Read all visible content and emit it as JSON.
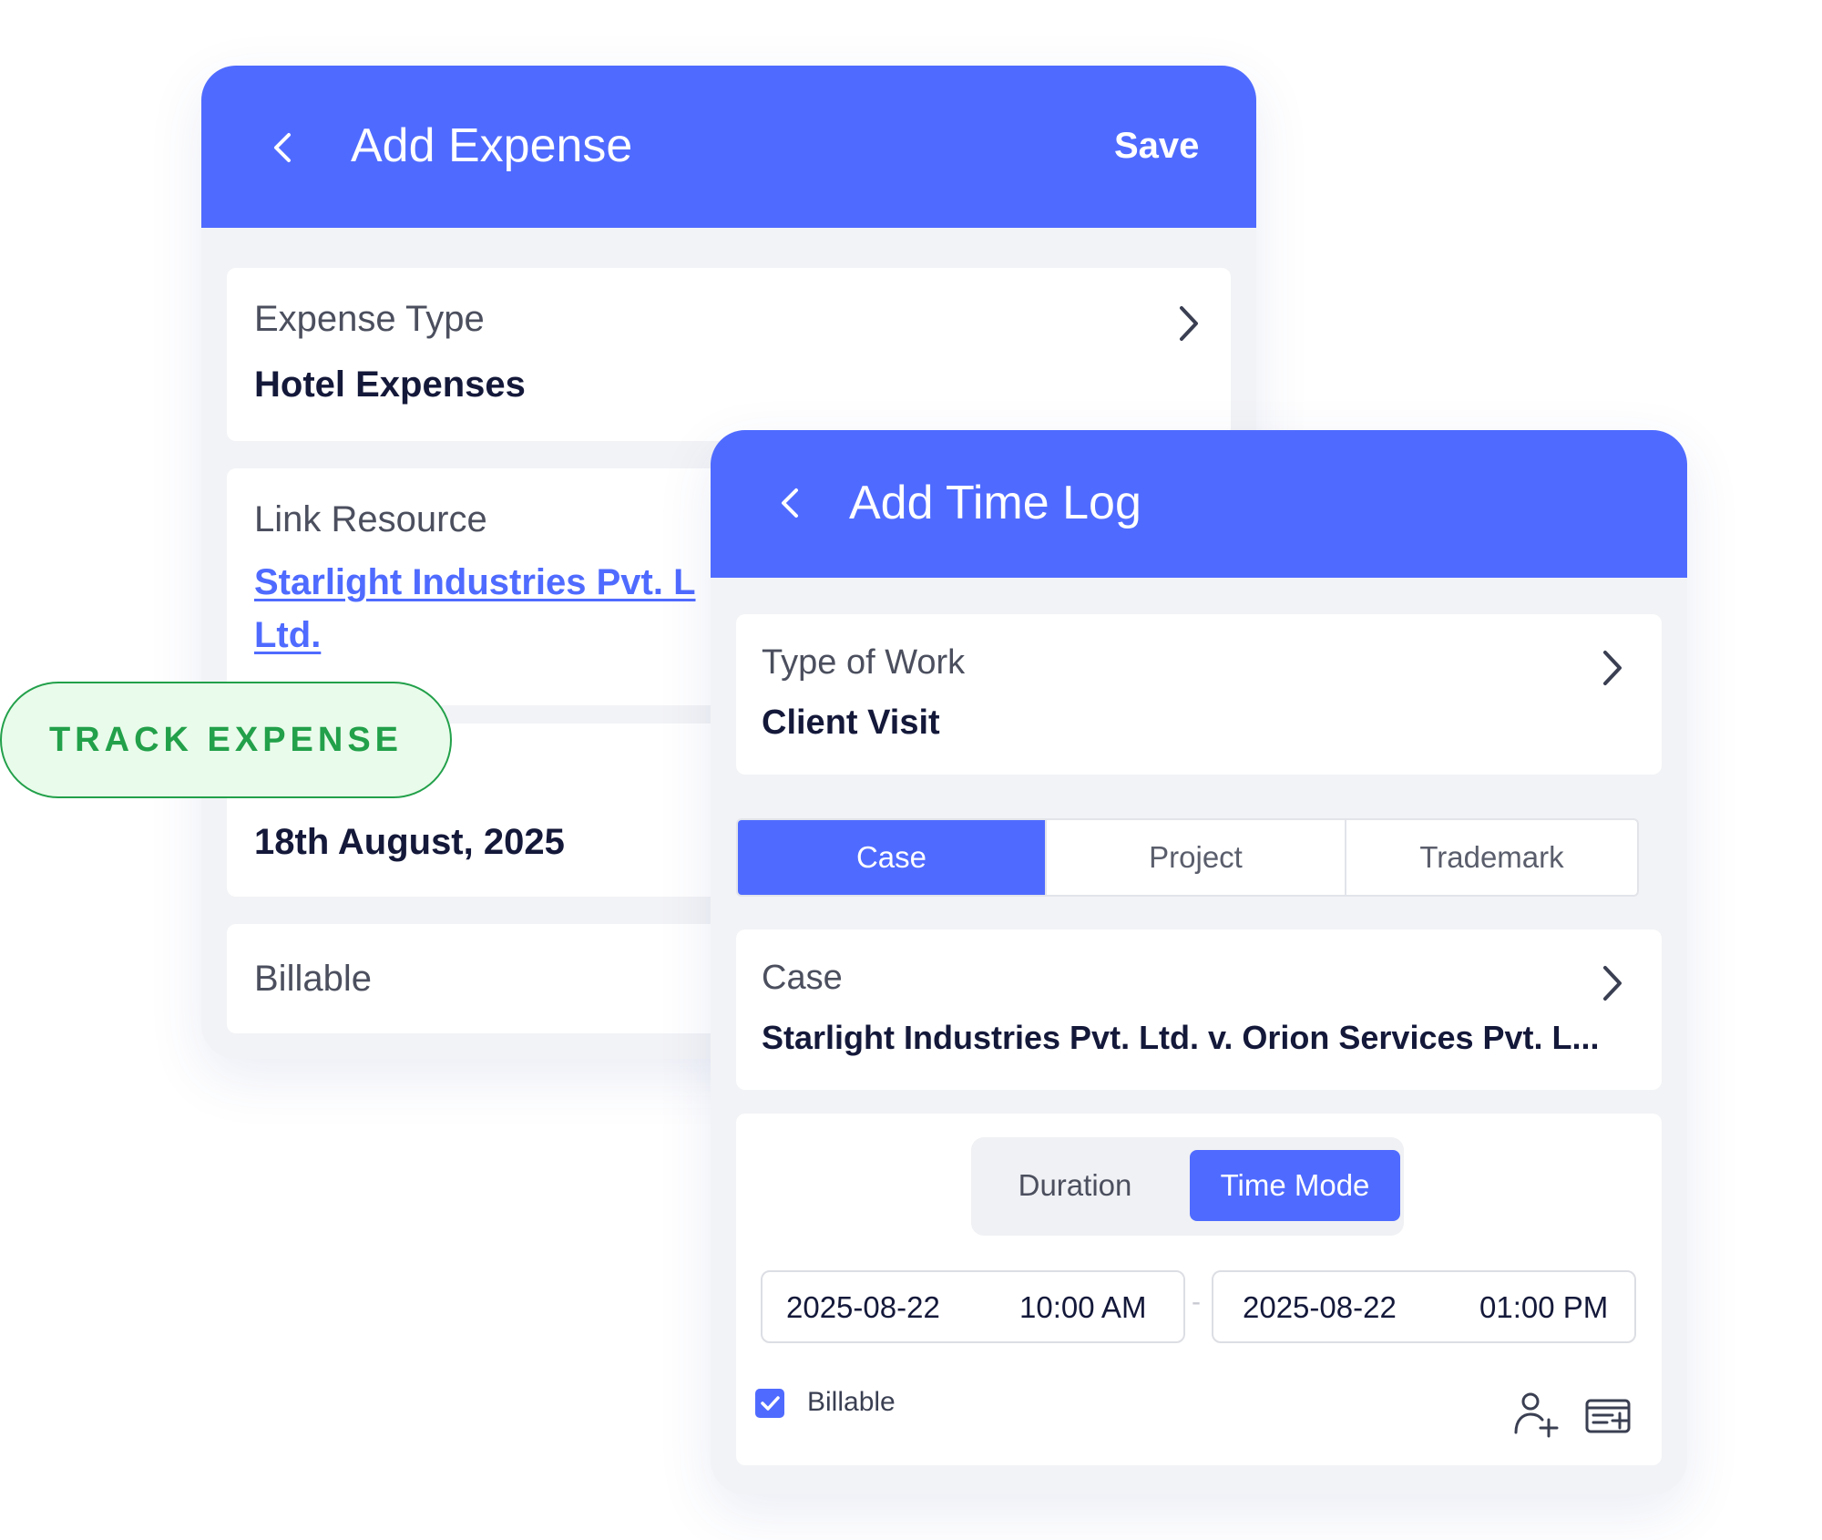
{
  "expense": {
    "title": "Add Expense",
    "save_label": "Save",
    "expense_type": {
      "label": "Expense Type",
      "value": "Hotel Expenses"
    },
    "link_resource": {
      "label": "Link Resource",
      "value_line1": "Starlight Industries Pvt. L",
      "value_line2": "Ltd."
    },
    "date_value": "18th August, 2025",
    "billable_label": "Billable"
  },
  "badge": {
    "label": "TRACK EXPENSE"
  },
  "timelog": {
    "title": "Add Time Log",
    "type_of_work": {
      "label": "Type of Work",
      "value": "Client Visit"
    },
    "tabs": [
      {
        "label": "Case",
        "active": true
      },
      {
        "label": "Project",
        "active": false
      },
      {
        "label": "Trademark",
        "active": false
      }
    ],
    "case": {
      "label": "Case",
      "value": "Starlight Industries Pvt. Ltd. v. Orion Services Pvt. L..."
    },
    "mode_toggle": {
      "duration": "Duration",
      "time_mode": "Time Mode",
      "selected": "Time Mode"
    },
    "start": {
      "date": "2025-08-22",
      "time": "10:00 AM"
    },
    "range_separator": "-",
    "end": {
      "date": "2025-08-22",
      "time": "01:00 PM"
    },
    "billable": {
      "label": "Billable",
      "checked": true
    }
  },
  "colors": {
    "accent": "#4f6bff",
    "badge_green": "#22a04a",
    "badge_bg": "#e9fbea",
    "card_bg": "#f2f3f6"
  }
}
